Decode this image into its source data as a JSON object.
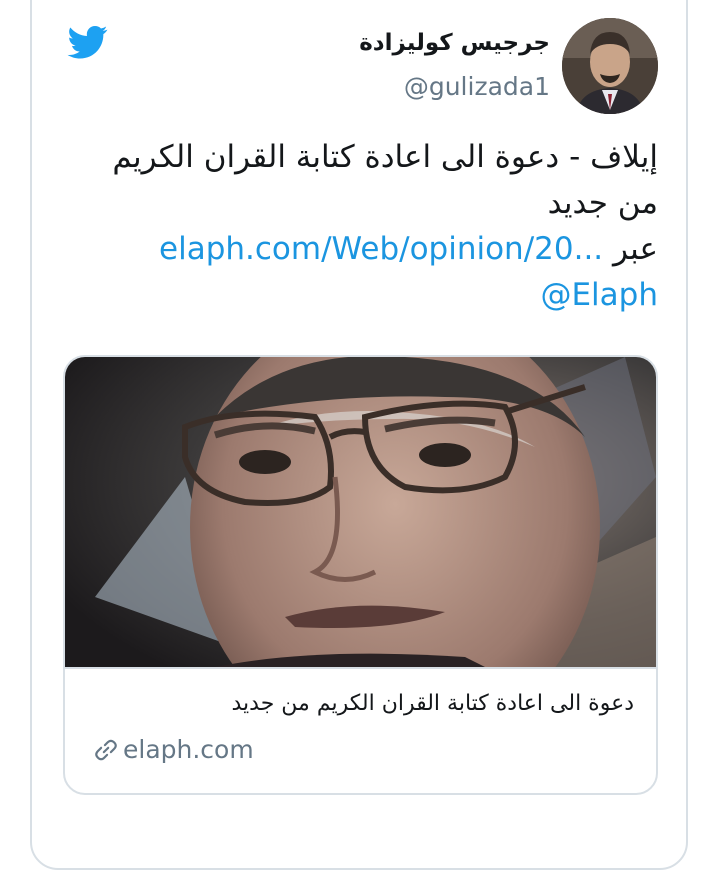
{
  "tweet": {
    "author": {
      "display_name": "جرجيس كوليزادة",
      "handle": "@gulizada1"
    },
    "text": {
      "body": "إيلاف - دعوة الى اعادة كتابة القران الكريم من جديد ",
      "via_label": "عبر",
      "link_text": "elaph.com/Web/opinion/20...",
      "mention": "@Elaph"
    },
    "preview": {
      "title": "دعوة الى اعادة كتابة القران الكريم من جديد",
      "domain": "elaph.com"
    }
  },
  "icons": {
    "brand": "twitter-bird-icon",
    "link": "link-icon"
  },
  "colors": {
    "twitter_blue": "#1da1f2",
    "link_blue": "#1b95e0",
    "secondary_text": "#657786",
    "primary_text": "#14171a",
    "border": "#d8dfe5"
  }
}
